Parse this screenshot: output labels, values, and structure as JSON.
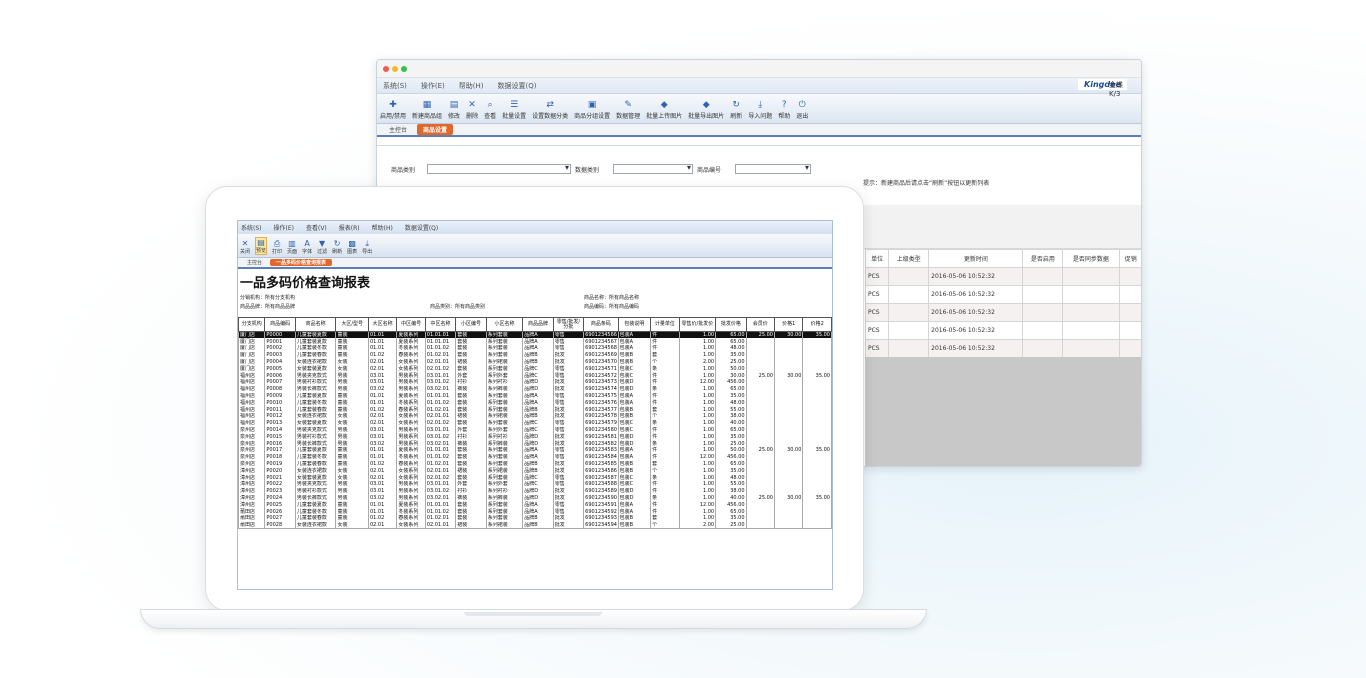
{
  "back_window": {
    "menu": [
      "系统(S)",
      "操作(E)",
      "帮助(H)",
      "数据设置(Q)"
    ],
    "brand": "Kingdee",
    "brand_suffix": "金蝶K/3",
    "toolbar": [
      "启用/禁用",
      "新建商品组",
      "修改",
      "删除",
      "查看",
      "批量设置",
      "设置数据分类",
      "商品分组设置",
      "数据管理",
      "批量上传图片",
      "批量导出图片",
      "刷新",
      "导入问题",
      "帮助",
      "退出"
    ],
    "tabs": {
      "home": "主控台",
      "active": "商品设置"
    },
    "filters": {
      "label1": "商品类别",
      "label2": "数据类别",
      "label3": "商品编号"
    },
    "hint": "提示：新建商品后请点击“刷新”按钮以更新列表",
    "grid": {
      "headers": [
        "单位",
        "上级类型",
        "更新时间",
        "是否启用",
        "是否同步数据",
        "促销"
      ],
      "rows": [
        [
          "PCS",
          "",
          "2016-05-06 10:52:32",
          "",
          "",
          ""
        ],
        [
          "PCS",
          "",
          "2016-05-06 10:52:32",
          "",
          "",
          ""
        ],
        [
          "PCS",
          "",
          "2016-05-06 10:52:32",
          "",
          "",
          ""
        ],
        [
          "PCS",
          "",
          "2016-05-06 10:52:32",
          "",
          "",
          ""
        ],
        [
          "PCS",
          "",
          "2016-05-06 10:52:32",
          "",
          "",
          ""
        ]
      ]
    },
    "colors": {
      "accent": "#e2672a",
      "header_blue": "#dce6f2"
    }
  },
  "front_window": {
    "menu": [
      "系统(S)",
      "操作(E)",
      "查看(V)",
      "报表(R)",
      "帮助(H)",
      "数据设置(Q)"
    ],
    "toolbar": [
      "关闭",
      "预览",
      "打印",
      "页面",
      "字体",
      "过滤",
      "刷新",
      "图表",
      "导出"
    ],
    "tabs": {
      "home": "主控台",
      "active": "一品多码价格查询报表"
    },
    "report_title": "一品多码价格查询报表",
    "info": {
      "org": "分销机构：所有分支机构",
      "brand": "商品品牌：所有商品品牌",
      "category": "商品类别：所有商品类别",
      "name": "商品名称：所有商品名称",
      "code": "商品编码：所有商品编码"
    },
    "columns": [
      "分支机构",
      "商品编码",
      "商品名称",
      "大区/型号",
      "大区名称",
      "中区编号",
      "中区名称",
      "小区编号",
      "小区名称",
      "商品品牌",
      "零售/批发/分批",
      "商品条码",
      "包装说明",
      "计量单位",
      "零售价/批发价",
      "批发价格",
      "会员价",
      "价格1",
      "价格2"
    ],
    "rows": [
      [
        "厦门店",
        "P0001",
        "儿童套装夏款",
        "童装",
        "01.01",
        "夏装系列",
        "01.01.01",
        "套装",
        "系列套装",
        "品牌A",
        "零售",
        "6901234567",
        "包装A",
        "件",
        "1.00",
        "65.00",
        "",
        "",
        ""
      ],
      [
        "厦门店",
        "P0002",
        "儿童套装冬款",
        "童装",
        "01.01",
        "冬装系列",
        "01.01.02",
        "套装",
        "系列套装",
        "品牌A",
        "零售",
        "6901234568",
        "包装A",
        "件",
        "1.00",
        "48.00",
        "",
        "",
        ""
      ],
      [
        "厦门店",
        "P0003",
        "儿童套装春款",
        "童装",
        "01.02",
        "春装系列",
        "01.02.01",
        "套装",
        "系列套装",
        "品牌B",
        "批发",
        "6901234569",
        "包装B",
        "套",
        "1.00",
        "35.00",
        "",
        "",
        ""
      ],
      [
        "厦门店",
        "P0004",
        "女装连衣裙款",
        "女装",
        "02.01",
        "女装系列",
        "02.01.01",
        "裙装",
        "系列裙装",
        "品牌B",
        "批发",
        "6901234570",
        "包装B",
        "个",
        "2.00",
        "25.00",
        "",
        "",
        ""
      ],
      [
        "厦门店",
        "P0005",
        "女装套装夏款",
        "女装",
        "02.01",
        "女装系列",
        "02.01.02",
        "套装",
        "系列套装",
        "品牌C",
        "零售",
        "6901234571",
        "包装C",
        "条",
        "1.00",
        "50.00",
        "",
        "",
        ""
      ],
      [
        "福州店",
        "P0006",
        "男装夹克款式",
        "男装",
        "03.01",
        "男装系列",
        "03.01.01",
        "外套",
        "系列外套",
        "品牌C",
        "零售",
        "6901234572",
        "包装C",
        "件",
        "1.00",
        "30.00",
        "25.00",
        "30.00",
        "35.00"
      ],
      [
        "福州店",
        "P0007",
        "男装衬衫款式",
        "男装",
        "03.01",
        "男装系列",
        "03.01.02",
        "衬衫",
        "系列衬衫",
        "品牌D",
        "批发",
        "6901234573",
        "包装D",
        "件",
        "12.00",
        "456.00",
        "",
        "",
        ""
      ],
      [
        "福州店",
        "P0008",
        "男装长裤款式",
        "男装",
        "03.02",
        "男装系列",
        "03.02.01",
        "裤装",
        "系列裤装",
        "品牌D",
        "批发",
        "6901234574",
        "包装D",
        "条",
        "1.00",
        "65.00",
        "",
        "",
        ""
      ],
      [
        "福州店",
        "P0009",
        "儿童套装夏款",
        "童装",
        "01.01",
        "夏装系列",
        "01.01.01",
        "套装",
        "系列套装",
        "品牌A",
        "零售",
        "6901234575",
        "包装A",
        "件",
        "1.00",
        "35.00",
        "",
        "",
        ""
      ],
      [
        "福州店",
        "P0010",
        "儿童套装冬款",
        "童装",
        "01.01",
        "冬装系列",
        "01.01.02",
        "套装",
        "系列套装",
        "品牌A",
        "零售",
        "6901234576",
        "包装A",
        "件",
        "1.00",
        "48.00",
        "",
        "",
        ""
      ],
      [
        "福州店",
        "P0011",
        "儿童套装春款",
        "童装",
        "01.02",
        "春装系列",
        "01.02.01",
        "套装",
        "系列套装",
        "品牌B",
        "批发",
        "6901234577",
        "包装B",
        "套",
        "1.00",
        "55.00",
        "",
        "",
        ""
      ],
      [
        "福州店",
        "P0012",
        "女装连衣裙款",
        "女装",
        "02.01",
        "女装系列",
        "02.01.01",
        "裙装",
        "系列裙装",
        "品牌B",
        "批发",
        "6901234578",
        "包装B",
        "个",
        "1.00",
        "38.00",
        "",
        "",
        ""
      ],
      [
        "福州店",
        "P0013",
        "女装套装夏款",
        "女装",
        "02.01",
        "女装系列",
        "02.01.02",
        "套装",
        "系列套装",
        "品牌C",
        "零售",
        "6901234579",
        "包装C",
        "条",
        "1.00",
        "40.00",
        "",
        "",
        ""
      ],
      [
        "泉州店",
        "P0014",
        "男装夹克款式",
        "男装",
        "03.01",
        "男装系列",
        "03.01.01",
        "外套",
        "系列外套",
        "品牌C",
        "零售",
        "6901234580",
        "包装C",
        "件",
        "1.00",
        "65.00",
        "",
        "",
        ""
      ],
      [
        "泉州店",
        "P0015",
        "男装衬衫款式",
        "男装",
        "03.01",
        "男装系列",
        "03.01.02",
        "衬衫",
        "系列衬衫",
        "品牌D",
        "批发",
        "6901234581",
        "包装D",
        "件",
        "1.00",
        "35.00",
        "",
        "",
        ""
      ],
      [
        "泉州店",
        "P0016",
        "男装长裤款式",
        "男装",
        "03.02",
        "男装系列",
        "03.02.01",
        "裤装",
        "系列裤装",
        "品牌D",
        "批发",
        "6901234582",
        "包装D",
        "条",
        "1.00",
        "25.00",
        "",
        "",
        ""
      ],
      [
        "泉州店",
        "P0017",
        "儿童套装夏款",
        "童装",
        "01.01",
        "夏装系列",
        "01.01.01",
        "套装",
        "系列套装",
        "品牌A",
        "零售",
        "6901234583",
        "包装A",
        "件",
        "1.00",
        "50.00",
        "25.00",
        "30.00",
        "35.00"
      ],
      [
        "泉州店",
        "P0018",
        "儿童套装冬款",
        "童装",
        "01.01",
        "冬装系列",
        "01.01.02",
        "套装",
        "系列套装",
        "品牌A",
        "零售",
        "6901234584",
        "包装A",
        "件",
        "12.00",
        "456.00",
        "",
        "",
        ""
      ],
      [
        "泉州店",
        "P0019",
        "儿童套装春款",
        "童装",
        "01.02",
        "春装系列",
        "01.02.01",
        "套装",
        "系列套装",
        "品牌B",
        "批发",
        "6901234585",
        "包装B",
        "套",
        "1.00",
        "65.00",
        "",
        "",
        ""
      ],
      [
        "漳州店",
        "P0020",
        "女装连衣裙款",
        "女装",
        "02.01",
        "女装系列",
        "02.01.01",
        "裙装",
        "系列裙装",
        "品牌B",
        "批发",
        "6901234586",
        "包装B",
        "个",
        "1.00",
        "35.00",
        "",
        "",
        ""
      ],
      [
        "漳州店",
        "P0021",
        "女装套装夏款",
        "女装",
        "02.01",
        "女装系列",
        "02.01.02",
        "套装",
        "系列套装",
        "品牌C",
        "零售",
        "6901234587",
        "包装C",
        "条",
        "1.00",
        "48.00",
        "",
        "",
        ""
      ],
      [
        "漳州店",
        "P0022",
        "男装夹克款式",
        "男装",
        "03.01",
        "男装系列",
        "03.01.01",
        "外套",
        "系列外套",
        "品牌C",
        "零售",
        "6901234588",
        "包装C",
        "件",
        "1.00",
        "55.00",
        "",
        "",
        ""
      ],
      [
        "漳州店",
        "P0023",
        "男装衬衫款式",
        "男装",
        "03.01",
        "男装系列",
        "03.01.02",
        "衬衫",
        "系列衬衫",
        "品牌D",
        "批发",
        "6901234589",
        "包装D",
        "件",
        "1.00",
        "38.00",
        "",
        "",
        ""
      ],
      [
        "漳州店",
        "P0024",
        "男装长裤款式",
        "男装",
        "03.02",
        "男装系列",
        "03.02.01",
        "裤装",
        "系列裤装",
        "品牌D",
        "批发",
        "6901234590",
        "包装D",
        "条",
        "1.00",
        "40.00",
        "25.00",
        "30.00",
        "35.00"
      ],
      [
        "漳州店",
        "P0025",
        "儿童套装夏款",
        "童装",
        "01.01",
        "夏装系列",
        "01.01.01",
        "套装",
        "系列套装",
        "品牌A",
        "零售",
        "6901234591",
        "包装A",
        "件",
        "12.00",
        "456.00",
        "",
        "",
        ""
      ],
      [
        "莆田店",
        "P0026",
        "儿童套装冬款",
        "童装",
        "01.01",
        "冬装系列",
        "01.01.02",
        "套装",
        "系列套装",
        "品牌A",
        "零售",
        "6901234592",
        "包装A",
        "件",
        "1.00",
        "65.00",
        "",
        "",
        ""
      ],
      [
        "莆田店",
        "P0027",
        "儿童套装春款",
        "童装",
        "01.02",
        "春装系列",
        "01.02.01",
        "套装",
        "系列套装",
        "品牌B",
        "批发",
        "6901234593",
        "包装B",
        "套",
        "1.00",
        "35.00",
        "",
        "",
        ""
      ],
      [
        "莆田店",
        "P0028",
        "女装连衣裙款",
        "女装",
        "02.01",
        "女装系列",
        "02.01.01",
        "裙装",
        "系列裙装",
        "品牌B",
        "批发",
        "6901234594",
        "包装B",
        "个",
        "2.00",
        "25.00",
        "",
        "",
        ""
      ]
    ],
    "highlighted_row": [
      "厦门店",
      "P0000",
      "儿童套装夏款",
      "童装",
      "01.01",
      "夏装系列",
      "01.01.01",
      "套装",
      "系列套装",
      "品牌A",
      "零售",
      "6901234566",
      "包装A",
      "件",
      "1.00",
      "65.00",
      "25.00",
      "30.00",
      "35.00"
    ]
  }
}
